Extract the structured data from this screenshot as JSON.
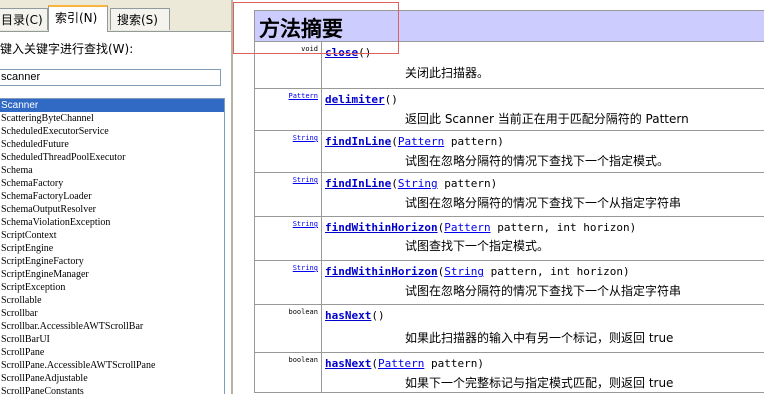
{
  "tabs": {
    "contents": "目录(C)",
    "index": "索引(N)",
    "search": "搜索(S)"
  },
  "keyword_label": "键入关键字进行查找(W):",
  "keyword_value": "scanner",
  "index_items": [
    "Scanner",
    "ScatteringByteChannel",
    "ScheduledExecutorService",
    "ScheduledFuture",
    "ScheduledThreadPoolExecutor",
    "Schema",
    "SchemaFactory",
    "SchemaFactoryLoader",
    "SchemaOutputResolver",
    "SchemaViolationException",
    "ScriptContext",
    "ScriptEngine",
    "ScriptEngineFactory",
    "ScriptEngineManager",
    "ScriptException",
    "Scrollable",
    "Scrollbar",
    "Scrollbar.AccessibleAWTScrollBar",
    "ScrollBarUI",
    "ScrollPane",
    "ScrollPane.AccessibleAWTScrollPane",
    "ScrollPaneAdjustable",
    "ScrollPaneConstants"
  ],
  "selected_index": 0,
  "summary_title": "方法摘要",
  "methods": [
    {
      "ret": "void",
      "ret_link": false,
      "name": "close",
      "open": "(",
      "ptype": "",
      "rest": ")",
      "desc": "关闭此扫描器。"
    },
    {
      "ret": "Pattern",
      "ret_link": true,
      "name": "delimiter",
      "open": "(",
      "ptype": "",
      "rest": ")",
      "desc": "返回此 Scanner 当前正在用于匹配分隔符的 Pattern"
    },
    {
      "ret": "String",
      "ret_link": true,
      "name": "findInLine",
      "open": "(",
      "ptype": "Pattern",
      "rest": " pattern)",
      "desc": "试图在忽略分隔符的情况下查找下一个指定模式。"
    },
    {
      "ret": "String",
      "ret_link": true,
      "name": "findInLine",
      "open": "(",
      "ptype": "String",
      "rest": " pattern)",
      "desc": "试图在忽略分隔符的情况下查找下一个从指定字符串"
    },
    {
      "ret": "String",
      "ret_link": true,
      "name": "findWithinHorizon",
      "open": "(",
      "ptype": "Pattern",
      "rest": " pattern, int horizon)",
      "desc": "试图查找下一个指定模式。"
    },
    {
      "ret": "String",
      "ret_link": true,
      "name": "findWithinHorizon",
      "open": "(",
      "ptype": "String",
      "rest": " pattern, int horizon)",
      "desc": "试图在忽略分隔符的情况下查找下一个从指定字符串"
    },
    {
      "ret": "boolean",
      "ret_link": false,
      "name": "hasNext",
      "open": "(",
      "ptype": "",
      "rest": ")",
      "desc": "如果此扫描器的输入中有另一个标记，则返回 true"
    },
    {
      "ret": "boolean",
      "ret_link": false,
      "name": "hasNext",
      "open": "(",
      "ptype": "Pattern",
      "rest": " pattern)",
      "desc": "如果下一个完整标记与指定模式匹配，则返回 true"
    }
  ]
}
